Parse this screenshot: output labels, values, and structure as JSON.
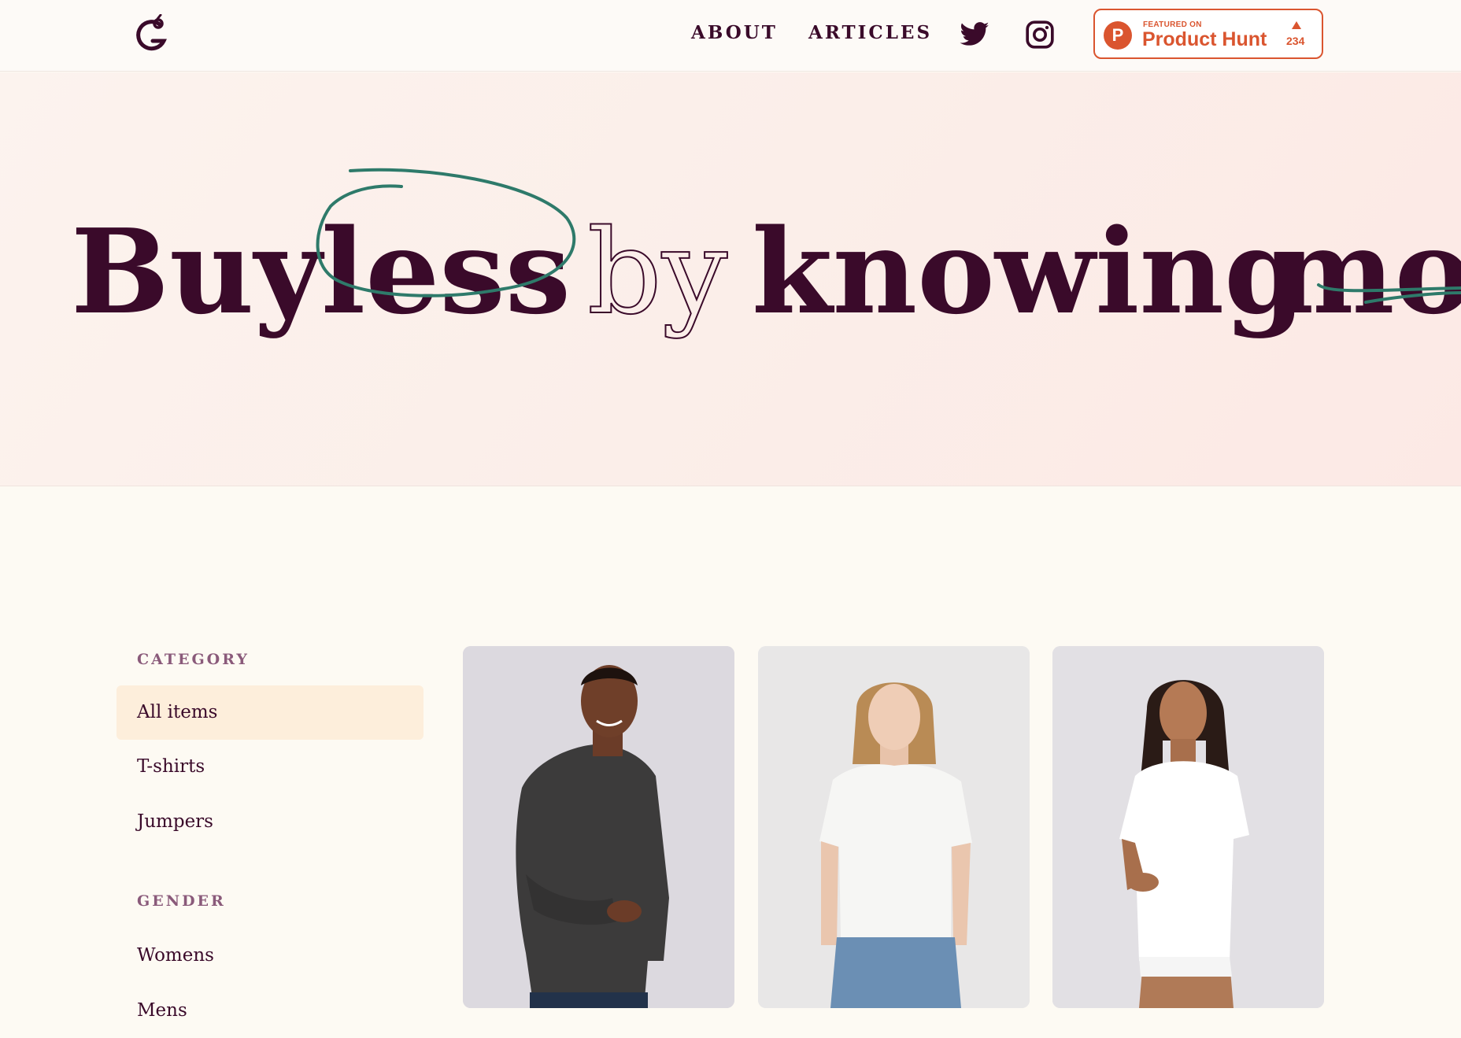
{
  "header": {
    "logo": "G",
    "nav": [
      {
        "label": "ABOUT"
      },
      {
        "label": "ARTICLES"
      }
    ],
    "social": {
      "twitter_icon": "twitter-icon",
      "instagram_icon": "instagram-icon"
    },
    "product_hunt": {
      "featured": "FEATURED ON",
      "name": "Product Hunt",
      "count": "234",
      "accent": "#da552f"
    }
  },
  "hero": {
    "word_buy": "Buy",
    "word_less": "less",
    "word_by": "by",
    "word_knowing": "knowing",
    "word_more": "more",
    "text_color": "#3a0a2a",
    "scribble_color": "#2e7a6a"
  },
  "filters": {
    "category_heading": "CATEGORY",
    "categories": [
      {
        "label": "All items",
        "active": true
      },
      {
        "label": "T-shirts",
        "active": false
      },
      {
        "label": "Jumpers",
        "active": false
      }
    ],
    "gender_heading": "GENDER",
    "genders": [
      {
        "label": "Womens"
      },
      {
        "label": "Mens"
      }
    ]
  },
  "products": [
    {
      "image": "man-in-dark-jumper"
    },
    {
      "image": "woman-in-white-tshirt-and-jeans"
    },
    {
      "image": "woman-in-white-tshirt"
    }
  ]
}
